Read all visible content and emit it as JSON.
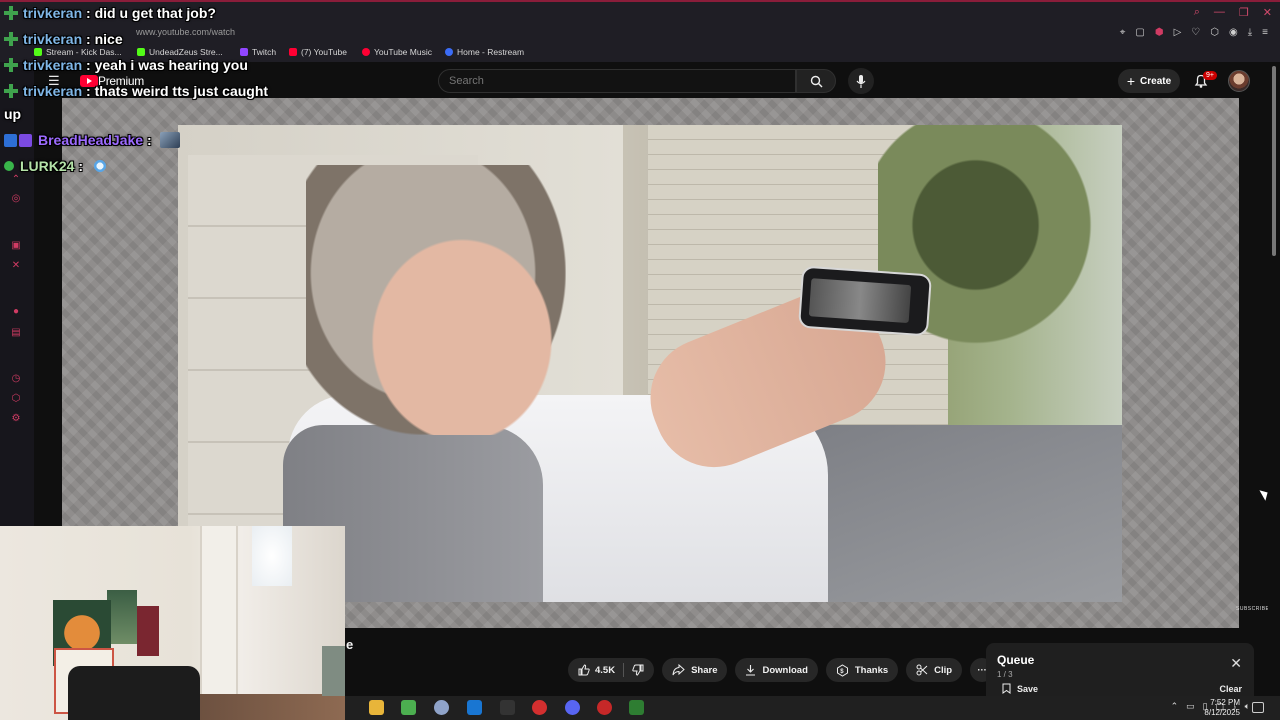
{
  "browser": {
    "url": "www.youtube.com/watch",
    "bookmarks": [
      {
        "label": "Stream - Kick Das...",
        "color": "#53fc18"
      },
      {
        "label": "UndeadZeus Stre...",
        "color": "#53fc18"
      },
      {
        "label": "Twitch",
        "color": "#9146ff"
      },
      {
        "label": "(7) YouTube",
        "color": "#ff0033"
      },
      {
        "label": "YouTube Music",
        "color": "#ff0033"
      },
      {
        "label": "Home - Restream",
        "color": "#3b6cf6"
      }
    ]
  },
  "youtube": {
    "logo_text": "Premium",
    "search_placeholder": "Search",
    "create_label": "Create",
    "notification_badge": "9+",
    "video_title_fragment": "e",
    "actions": {
      "likes": "4.5K",
      "share": "Share",
      "download": "Download",
      "thanks": "Thanks",
      "clip": "Clip",
      "more": "···"
    },
    "queue": {
      "title": "Queue",
      "count": "1 / 3",
      "save": "Save",
      "clear": "Clear"
    },
    "watermark": "SUBSCRIBE"
  },
  "chat": [
    {
      "user": "trivkeran",
      "message": "did u get that job?"
    },
    {
      "user": "trivkeran",
      "message": "nice"
    },
    {
      "user": "trivkeran",
      "message": "yeah i was hearing you"
    },
    {
      "user": "trivkeran",
      "message": "thats weird tts just caught"
    },
    {
      "user": "",
      "message": "up"
    },
    {
      "user": "BreadHeadJake",
      "message": ""
    },
    {
      "user": "LURK24",
      "message": ""
    }
  ],
  "chat_separator": " : ",
  "taskbar": {
    "time": "7:52 PM",
    "date": "8/12/2025"
  },
  "colors": {
    "accent": "#ff0033",
    "chat_user": "#7fb6e6",
    "sidebar_icon": "#d03b63"
  }
}
